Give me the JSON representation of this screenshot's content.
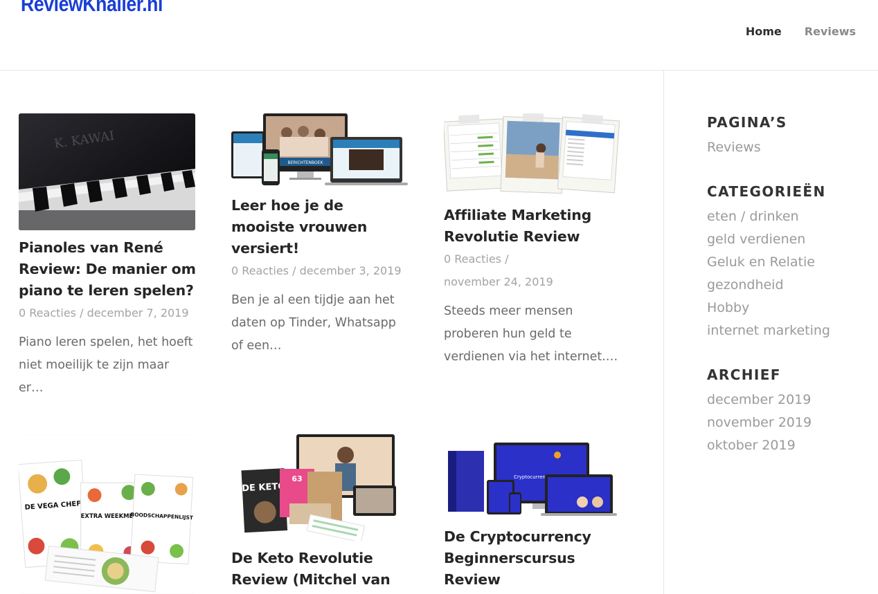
{
  "site": {
    "logo": "ReviewKnaller.nl"
  },
  "nav": [
    {
      "label": "Home",
      "active": true
    },
    {
      "label": "Reviews",
      "active": false
    }
  ],
  "posts": [
    {
      "title": "Pianoles van René Review: De manier om piano te leren spelen?",
      "comments": "0 Reacties",
      "date": "december 7, 2019",
      "excerpt": "Piano leren spelen, het hoeft niet moeilijk te zijn maar er…"
    },
    {
      "title": "Leer hoe je de mooiste vrouwen versiert!",
      "comments": "0 Reacties",
      "date": "december 3, 2019",
      "excerpt": "Ben je al een tijdje aan het daten op Tinder, Whatsapp of een…",
      "thumb_text": "BERICHTENBOEK"
    },
    {
      "title": "Affiliate Marketing Revolutie Review",
      "comments": "0 Reacties",
      "date": "november 24, 2019",
      "excerpt": "Steeds meer mensen proberen hun geld te verdienen via het internet.…"
    },
    {
      "title": "",
      "thumb_text": [
        "DE VEGA CHEF",
        "EXTRA WEEKMENU",
        "BOODSCHAPPENLIJST"
      ]
    },
    {
      "title": "De Keto Revolutie Review (Mitchel van",
      "thumb_text": [
        "DE KETO",
        "63"
      ]
    },
    {
      "title": "De Cryptocurrency Beginnerscursus Review",
      "thumb_text": [
        "Cryptocurrency Cursus"
      ]
    }
  ],
  "sidebar": {
    "pages_title": "PAGINA’S",
    "pages": [
      "Reviews"
    ],
    "categories_title": "CATEGORIEËN",
    "categories": [
      "eten / drinken",
      "geld verdienen",
      "Geluk en Relatie",
      "gezondheid",
      "Hobby",
      "internet marketing"
    ],
    "archive_title": "ARCHIEF",
    "archive": [
      "december 2019",
      "november 2019",
      "oktober 2019"
    ]
  },
  "colors": {
    "brand": "#1a3fd6",
    "text": "#262626",
    "muted": "#a3a3a3"
  }
}
